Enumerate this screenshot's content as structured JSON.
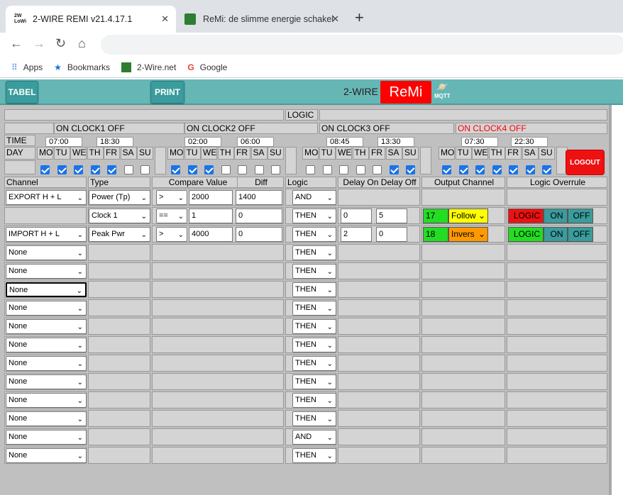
{
  "browser": {
    "tabs": [
      {
        "title": "2-WIRE REMI v21.4.17.1"
      },
      {
        "title": "ReMi: de slimme energie schakel"
      }
    ],
    "bookmarks": [
      "Apps",
      "Bookmarks",
      "2-Wire.net",
      "Google"
    ]
  },
  "header": {
    "tabel": "TABEL",
    "print": "PRINT",
    "brand": "2-WIRE",
    "logo": "ReMi",
    "mqtt": "MQTT"
  },
  "logic_label": "LOGIC",
  "clocks": [
    "ON CLOCK1 OFF",
    "ON CLOCK2 OFF",
    "ON CLOCK3 OFF",
    "ON CLOCK4 OFF"
  ],
  "time_label": "TIME",
  "day_label": "DAY",
  "times": [
    "07:00",
    "18:30",
    "02:00",
    "06:00",
    "08:45",
    "13:30",
    "07:30",
    "22:30"
  ],
  "days": [
    "MO",
    "TU",
    "WE",
    "TH",
    "FR",
    "SA",
    "SU"
  ],
  "checks": [
    [
      1,
      1,
      1,
      1,
      1,
      0,
      0
    ],
    [
      1,
      1,
      1,
      0,
      0,
      0,
      0
    ],
    [
      0,
      0,
      0,
      0,
      0,
      1,
      1
    ],
    [
      1,
      1,
      1,
      1,
      1,
      1,
      1
    ]
  ],
  "logout": "LOGOUT",
  "columns": {
    "channel": "Channel",
    "type": "Type",
    "compare": "Compare Value",
    "diff": "Diff",
    "logic": "Logic",
    "delay": "Delay On Delay Off",
    "output": "Output Channel",
    "override": "Logic Overrule"
  },
  "rows": [
    {
      "channel": "EXPORT H + L",
      "type": "Power (Tp)",
      "op": ">",
      "value": "2000",
      "diff": "1400",
      "logic": "AND"
    },
    {
      "channel": "",
      "type": "Clock 1",
      "op": "==",
      "value": "1",
      "diff": "0",
      "logic": "THEN",
      "d_on": "0",
      "d_off": "5",
      "out_num": "17",
      "out_mode": "Follow",
      "ov": [
        "LOGIC",
        "ON",
        "OFF"
      ]
    },
    {
      "channel": "IMPORT H + L",
      "type": "Peak Pwr",
      "op": ">",
      "value": "4000",
      "diff": "0",
      "logic": "THEN",
      "d_on": "2",
      "d_off": "0",
      "out_num": "18",
      "out_mode": "Invers",
      "ov": [
        "LOGIC",
        "ON",
        "OFF"
      ]
    },
    {
      "channel": "None",
      "logic": "THEN"
    },
    {
      "channel": "None",
      "logic": "THEN"
    },
    {
      "channel": "None",
      "logic": "THEN"
    },
    {
      "channel": "None",
      "logic": "THEN"
    },
    {
      "channel": "None",
      "logic": "THEN"
    },
    {
      "channel": "None",
      "logic": "THEN"
    },
    {
      "channel": "None",
      "logic": "THEN"
    },
    {
      "channel": "None",
      "logic": "THEN"
    },
    {
      "channel": "None",
      "logic": "THEN"
    },
    {
      "channel": "None",
      "logic": "THEN"
    },
    {
      "channel": "None",
      "logic": "AND"
    },
    {
      "channel": "None",
      "logic": "THEN"
    }
  ],
  "colors": {
    "header": "#67b6b6",
    "logo": "#ff0000",
    "follow": "#ffff00",
    "invers": "#ff9900",
    "green": "#22dd22",
    "red": "#ee1111"
  }
}
